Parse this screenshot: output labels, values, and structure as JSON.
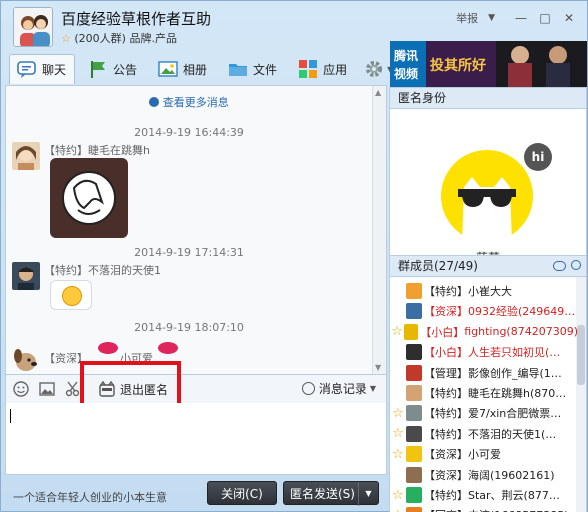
{
  "window": {
    "title": "百度经验草根作者互助",
    "subtitle_star": "☆",
    "subtitle": "(200人群) 品牌.产品",
    "report": "举报",
    "report_arrow": "▼",
    "minimize": "—",
    "maximize": "□",
    "close": "✕"
  },
  "tabs": [
    {
      "label": "聊天",
      "icon": "chat-icon"
    },
    {
      "label": "公告",
      "icon": "flag-icon"
    },
    {
      "label": "相册",
      "icon": "album-icon"
    },
    {
      "label": "文件",
      "icon": "folder-icon"
    },
    {
      "label": "应用",
      "icon": "apps-icon"
    }
  ],
  "ad": {
    "brand_line1": "腾讯",
    "brand_line2": "视频",
    "show": "投其所好"
  },
  "chat": {
    "more_link": "查看更多消息",
    "messages": [
      {
        "time": "2014-9-19 16:44:39",
        "name": "【特约】睫毛在跳舞h"
      },
      {
        "time": "2014-9-19 17:14:31",
        "name": "【特约】不落泪的天使1"
      },
      {
        "time": "2014-9-19 18:07:10",
        "name": "【资深】",
        "name2": "小可爱"
      }
    ]
  },
  "toolbar": {
    "exit_anonymous": "退出匿名",
    "history": "消息记录",
    "history_arrow": "▼"
  },
  "bottom": {
    "ad_text": "一个适合年轻人创业的小本生意",
    "close_button": "关闭(C)",
    "send_button": "匿名发送(S)",
    "send_arrow": "▼"
  },
  "anonymous": {
    "header": "匿名身份",
    "badge": "hi",
    "name": "菠萝"
  },
  "members": {
    "header": "群成员(27/49)",
    "items": [
      {
        "tag": "【特约】",
        "name": "小崔大大",
        "color": "#222222",
        "star": ""
      },
      {
        "tag": "【资深】",
        "name": "0932经验(249649…",
        "color": "#d42020",
        "star": ""
      },
      {
        "tag": "【小白】",
        "name": "fighting(874207309)",
        "color": "#d42020",
        "star": "☆"
      },
      {
        "tag": "【小白】",
        "name": "人生若只如初见(…",
        "color": "#d42020",
        "star": ""
      },
      {
        "tag": "【管理】",
        "name": "影像创作_编导(1…",
        "color": "#222222",
        "star": ""
      },
      {
        "tag": "【特约】",
        "name": "睫毛在跳舞h(870…",
        "color": "#222222",
        "star": ""
      },
      {
        "tag": "【特约】",
        "name": "爱7/xin合肥微票…",
        "color": "#222222",
        "star": "☆"
      },
      {
        "tag": "【特约】",
        "name": "不落泪的天使1(…",
        "color": "#222222",
        "star": "☆"
      },
      {
        "tag": "【资深】",
        "name": "小可爱",
        "color": "#222222",
        "star": "☆"
      },
      {
        "tag": "【资深】",
        "name": "海阔(19602161)",
        "color": "#222222",
        "star": ""
      },
      {
        "tag": "【特约】",
        "name": "Star、荆云(877…",
        "color": "#222222",
        "star": "☆"
      },
      {
        "tag": "【回高】",
        "name": "中流(1668577385)",
        "color": "#222222",
        "star": "☆"
      }
    ]
  }
}
